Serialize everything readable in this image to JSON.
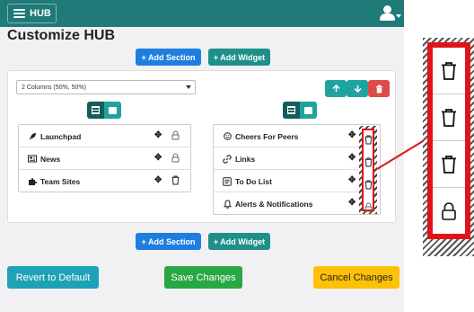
{
  "header": {
    "app_name": "HUB",
    "menu_icon": "hamburger-icon",
    "user_icon": "user-icon"
  },
  "page_title": "Customize HUB",
  "top_actions": {
    "add_section": "+ Add Section",
    "add_widget": "+ Add Widget"
  },
  "bottom_actions": {
    "add_section": "+ Add Section",
    "add_widget": "+ Add Widget"
  },
  "layout": {
    "selected_layout": "2 Columns (50%, 50%)",
    "section_controls": [
      "up-arrow-icon",
      "down-arrow-icon",
      "trash-icon"
    ],
    "left_column": {
      "items": [
        {
          "label": "Launchpad",
          "icon": "rocket-icon",
          "action": "lock-icon"
        },
        {
          "label": "News",
          "icon": "newspaper-icon",
          "action": "lock-icon"
        },
        {
          "label": "Team Sites",
          "icon": "puzzle-icon",
          "action": "trash-icon"
        }
      ]
    },
    "right_column": {
      "items": [
        {
          "label": "Cheers For Peers",
          "icon": "smile-icon",
          "action": "trash-icon"
        },
        {
          "label": "Links",
          "icon": "link-icon",
          "action": "trash-icon"
        },
        {
          "label": "To Do List",
          "icon": "checklist-icon",
          "action": "trash-icon"
        },
        {
          "label": "Alerts & Notifications",
          "icon": "bell-icon",
          "action": "lock-icon"
        }
      ]
    }
  },
  "footer": {
    "revert": "Revert to Default",
    "save": "Save Changes",
    "cancel": "Cancel Changes"
  },
  "callout": {
    "icons": [
      "trash-icon",
      "trash-icon",
      "trash-icon",
      "lock-icon"
    ]
  },
  "colors": {
    "header": "#1f7a78",
    "primary": "#1e7ee0",
    "teal": "#1f8f8a",
    "danger": "#e04a4a",
    "success": "#28a745",
    "warning": "#ffc107",
    "highlight": "#e0131b"
  }
}
